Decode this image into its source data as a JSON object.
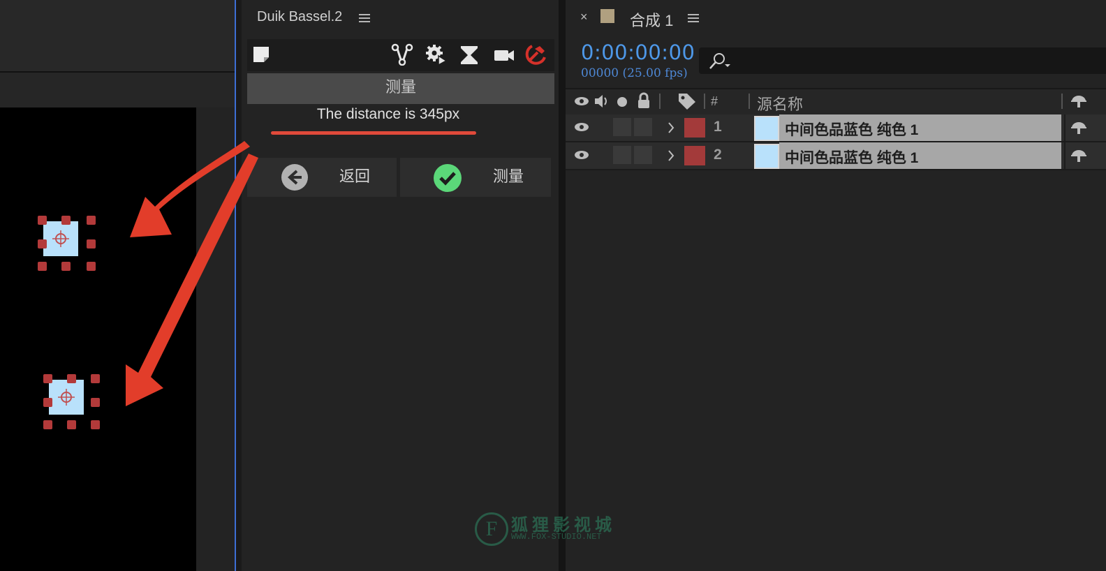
{
  "duik_panel": {
    "title": "Duik Bassel.2",
    "section_title": "测量",
    "distance_text": "The distance is 345px",
    "back_label": "返回",
    "measure_label": "测量"
  },
  "timeline_panel": {
    "close_glyph": "×",
    "comp_name": "合成 1",
    "timecode": "0:00:00:00",
    "frame_info": "00000 (25.00 fps)",
    "column_hash": "#",
    "column_source_name": "源名称",
    "layers": [
      {
        "index": "1",
        "name": "中间色品蓝色 纯色 1",
        "label_color": "#a33a3a",
        "solid_color": "#b9e1fb"
      },
      {
        "index": "2",
        "name": "中间色品蓝色 纯色 1",
        "label_color": "#a33a3a",
        "solid_color": "#b9e1fb"
      }
    ]
  },
  "watermark": {
    "logo_letter": "F",
    "name": "狐狸影视城",
    "url": "WWW.FOX-STUDIO.NET"
  },
  "colors": {
    "accent_blue": "#4e98e8",
    "annotation_red": "#e23d2a",
    "layer_red": "#a33a3a",
    "solid_blue": "#b9e1fb"
  }
}
